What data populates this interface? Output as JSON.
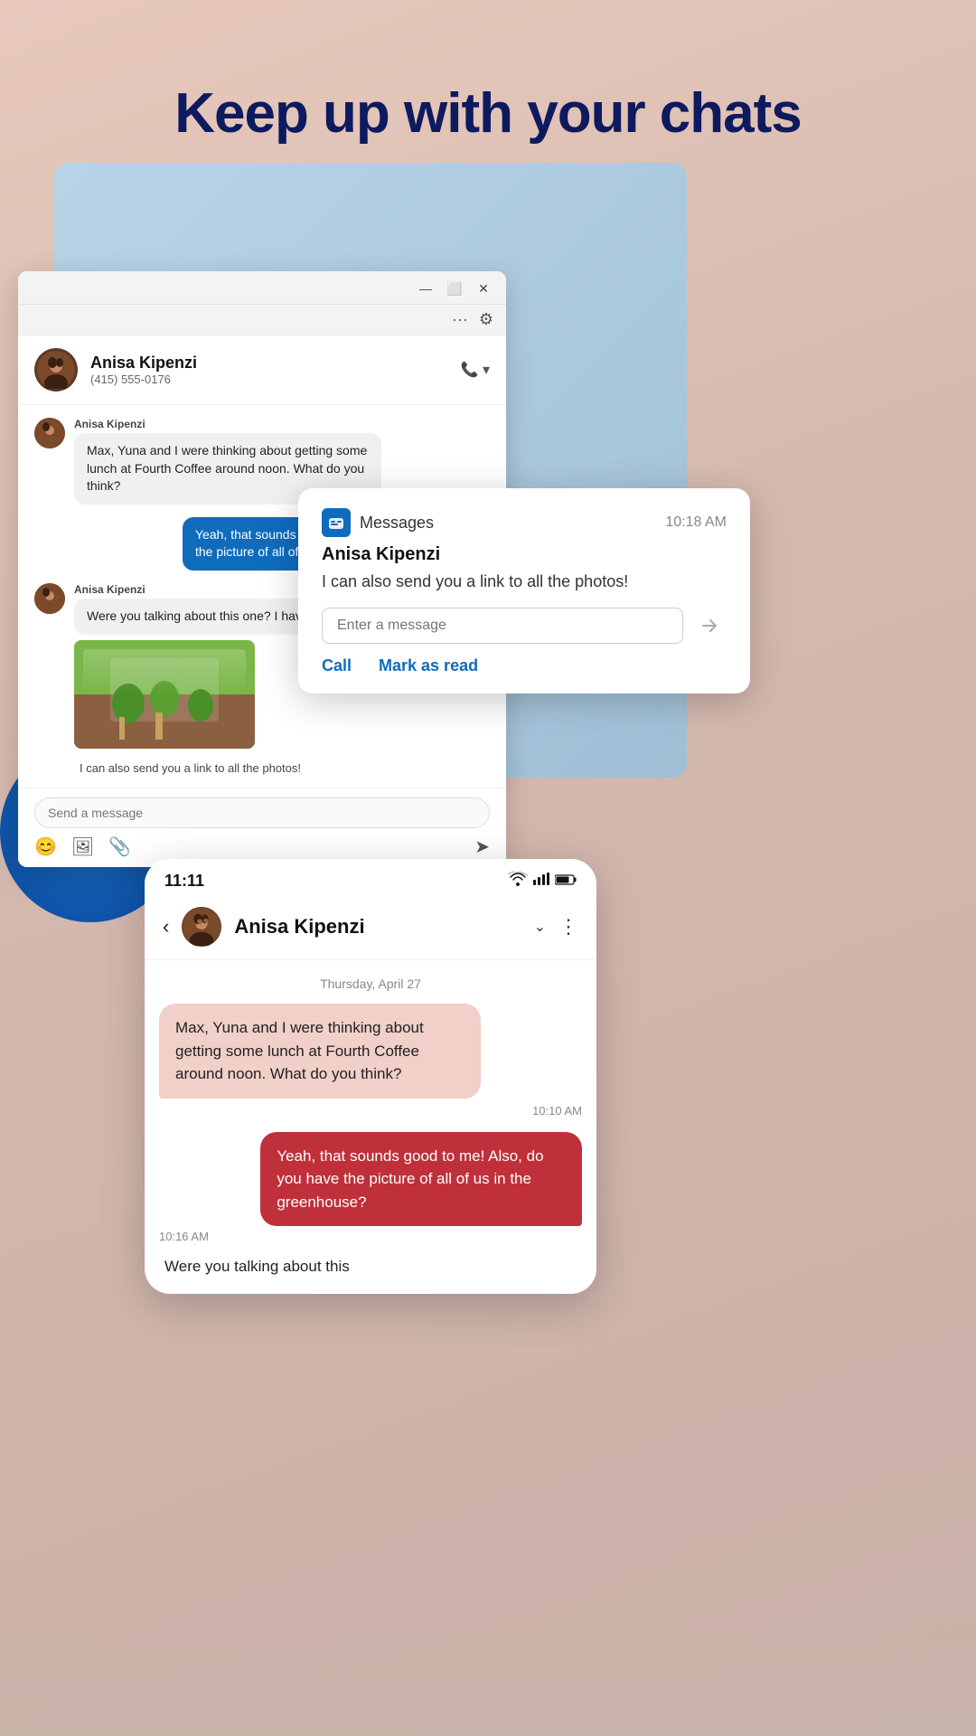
{
  "page": {
    "title": "Keep up with your chats",
    "bg_color": "#e8c9bc"
  },
  "desktop_window": {
    "contact_name": "Anisa Kipenzi",
    "contact_phone": "(415) 555-0176",
    "messages": [
      {
        "sender": "Anisa Kipenzi",
        "text": "Max, Yuna and I were thinking about getting some lunch at Fourth Coffee around noon. What do you think?",
        "type": "received"
      },
      {
        "sender": "",
        "text": "Yeah, that sounds good to me! Also, do you have the picture of all of us in the greenhouse?",
        "type": "sent"
      },
      {
        "sender": "Anisa Kipenzi",
        "text": "Were you talking about this one? I have a few m...",
        "type": "received"
      },
      {
        "sender": "",
        "text": "I can also send you a link to all the photos!",
        "type": "received_small"
      }
    ],
    "send_placeholder": "Send a message"
  },
  "notification": {
    "app_name": "Messages",
    "time": "10:18 AM",
    "contact": "Anisa Kipenzi",
    "message": "I can also send you a link to all the photos!",
    "input_placeholder": "Enter a message",
    "actions": {
      "call": "Call",
      "mark_as_read": "Mark as read"
    }
  },
  "phone": {
    "status_time": "11:11",
    "contact_name": "Anisa Kipenzi",
    "date_label": "Thursday, April 27",
    "messages": [
      {
        "text": "Max, Yuna and I were thinking about getting some lunch at Fourth Coffee around noon. What do you think?",
        "type": "received",
        "time": "10:10 AM"
      },
      {
        "text": "Yeah, that sounds good to me! Also, do you have the picture of all of us in the greenhouse?",
        "type": "sent",
        "time": "10:16 AM"
      },
      {
        "text": "Were you talking about this",
        "type": "received_partial",
        "time": ""
      }
    ]
  }
}
